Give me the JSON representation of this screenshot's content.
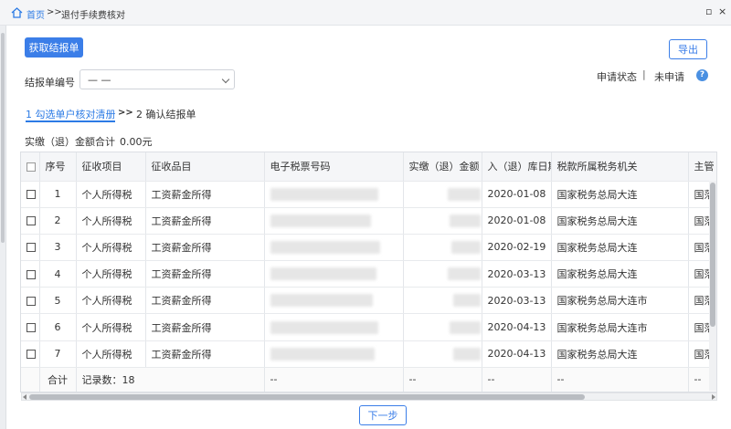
{
  "titlebar": {
    "home": "首页",
    "sep": ">>",
    "current": "退付手续费核对",
    "restore_glyph": "▫",
    "close_glyph": "×"
  },
  "toolbar": {
    "fetch_label": "获取结报单",
    "export_label": "导出"
  },
  "form": {
    "jbd_label": "结报单编号",
    "jbd_value": "— —"
  },
  "status": {
    "label": "申请状态",
    "sep": "|",
    "value": "未申请",
    "help": "?"
  },
  "steps": {
    "step1": "1 勾选单户核对清册",
    "arrow": ">>",
    "step2": "2 确认结报单"
  },
  "summary": {
    "label": "实缴（退）金额合计",
    "value": "0.00元"
  },
  "table": {
    "columns": [
      "序号",
      "征收项目",
      "征收品目",
      "电子税票号码",
      "实缴（退）金额",
      "入（退）库日期",
      "税款所属税务机关",
      "主管"
    ],
    "rows": [
      {
        "no": "1",
        "item": "个人所得税",
        "sub": "工资薪金所得",
        "date": "2020-01-08",
        "org": "国家税务总局大连",
        "mgr": "国落"
      },
      {
        "no": "2",
        "item": "个人所得税",
        "sub": "工资薪金所得",
        "date": "2020-01-08",
        "org": "国家税务总局大连",
        "mgr": "国落"
      },
      {
        "no": "3",
        "item": "个人所得税",
        "sub": "工资薪金所得",
        "date": "2020-02-19",
        "org": "国家税务总局大连",
        "mgr": "国落"
      },
      {
        "no": "4",
        "item": "个人所得税",
        "sub": "工资薪金所得",
        "date": "2020-03-13",
        "org": "国家税务总局大连",
        "mgr": "国落"
      },
      {
        "no": "5",
        "item": "个人所得税",
        "sub": "工资薪金所得",
        "date": "2020-03-13",
        "org": "国家税务总局大连市",
        "mgr": "国落"
      },
      {
        "no": "6",
        "item": "个人所得税",
        "sub": "工资薪金所得",
        "date": "2020-04-13",
        "org": "国家税务总局大连市",
        "mgr": "国落"
      },
      {
        "no": "7",
        "item": "个人所得税",
        "sub": "工资薪金所得",
        "date": "2020-04-13",
        "org": "国家税务总局大连",
        "mgr": "国落"
      }
    ],
    "footer": {
      "total_label": "合计",
      "count_label": "记录数：18",
      "dash": "--"
    }
  },
  "footer": {
    "next_label": "下一步"
  },
  "colors": {
    "accent": "#3b7ee8",
    "link": "#2c7be5"
  }
}
